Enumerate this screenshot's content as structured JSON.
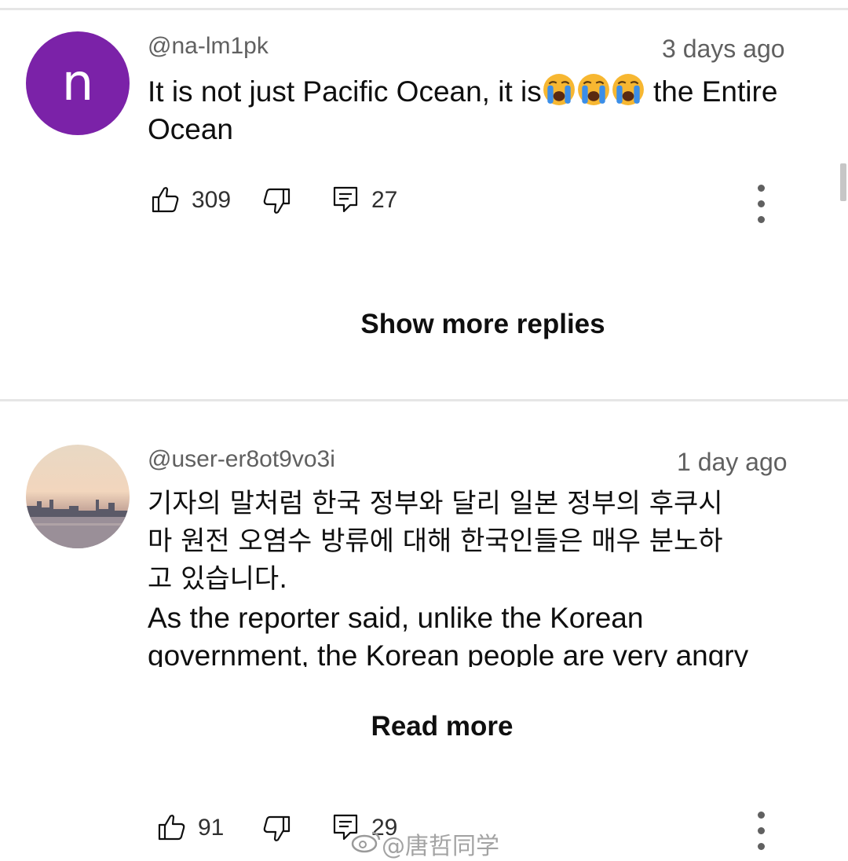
{
  "comments": [
    {
      "handle": "@na-lm1pk",
      "time": "3 days ago",
      "avatar_letter": "n",
      "text_part1": "It is not just Pacific Ocean, it is",
      "text_part2": " the Entire",
      "text_line2": "Ocean",
      "emoji": "loudly-crying-face",
      "likes": "309",
      "replies": "27"
    },
    {
      "handle": "@user-er8ot9vo3i",
      "time": "1 day ago",
      "lines": [
        "기자의 말처럼 한국 정부와 달리 일본 정부의 후쿠시",
        "마 원전 오염수 방류에 대해 한국인들은 매우 분노하",
        "고 있습니다.",
        "As the reporter said, unlike the Korean",
        "government, the Korean people are very angry"
      ],
      "likes": "91",
      "replies": "29"
    }
  ],
  "show_more_replies": "Show more replies",
  "read_more": "Read more",
  "watermark": "@唐哲同学",
  "colors": {
    "avatar_bg": "#7b22a8",
    "secondary_text": "#606060"
  }
}
